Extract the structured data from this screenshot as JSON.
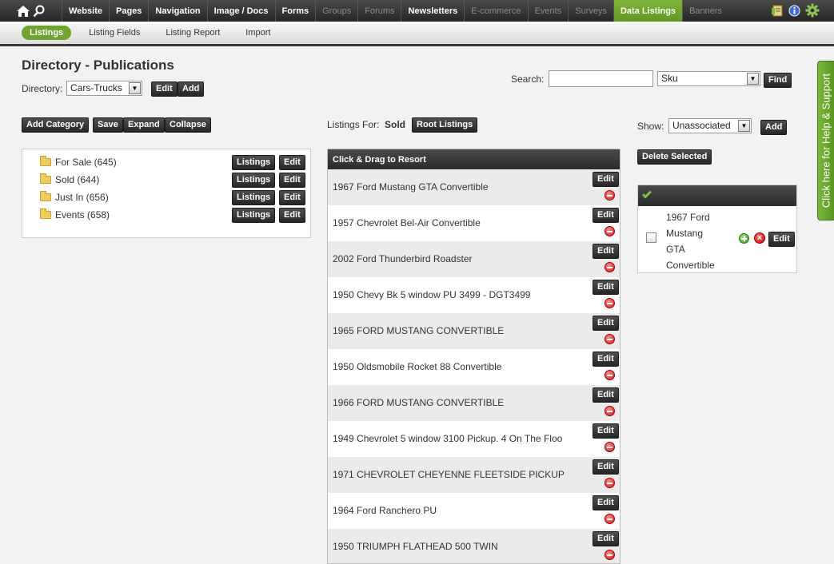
{
  "topnav": {
    "items": [
      {
        "label": "Website",
        "state": "normal"
      },
      {
        "label": "Pages",
        "state": "normal"
      },
      {
        "label": "Navigation",
        "state": "normal"
      },
      {
        "label": "Image / Docs",
        "state": "normal"
      },
      {
        "label": "Forms",
        "state": "normal"
      },
      {
        "label": "Groups",
        "state": "dim"
      },
      {
        "label": "Forums",
        "state": "dim"
      },
      {
        "label": "Newsletters",
        "state": "normal"
      },
      {
        "label": "E-commerce",
        "state": "dim"
      },
      {
        "label": "Events",
        "state": "dim"
      },
      {
        "label": "Surveys",
        "state": "dim"
      },
      {
        "label": "Data Listings",
        "state": "active"
      },
      {
        "label": "Banners",
        "state": "dim"
      }
    ],
    "icons": [
      "home-icon",
      "search-icon",
      "notes-icon",
      "info-icon",
      "gear-icon"
    ]
  },
  "subnav": {
    "items": [
      {
        "label": "Listings",
        "active": true
      },
      {
        "label": "Listing Fields",
        "active": false
      },
      {
        "label": "Listing Report",
        "active": false
      },
      {
        "label": "Import",
        "active": false
      }
    ]
  },
  "page": {
    "title": "Directory - Publications",
    "directory_label": "Directory:",
    "directory_value": "Cars-Trucks",
    "edit_label": "Edit",
    "add_label": "Add"
  },
  "search": {
    "label": "Search:",
    "value": "",
    "field_value": "Sku",
    "find_label": "Find"
  },
  "tree_toolbar": {
    "add_category": "Add Category",
    "save": "Save",
    "expand": "Expand",
    "collapse": "Collapse"
  },
  "categories": [
    {
      "name": "For Sale (645)"
    },
    {
      "name": "Sold (644)"
    },
    {
      "name": "Just In (656)"
    },
    {
      "name": "Events (658)"
    }
  ],
  "tree_row_buttons": {
    "listings": "Listings",
    "edit": "Edit"
  },
  "listings": {
    "for_label": "Listings For:",
    "for_value": "Sold",
    "root_button": "Root Listings",
    "header": "Click & Drag to Resort",
    "edit_label": "Edit",
    "items": [
      "1967 Ford Mustang GTA Convertible",
      "1957 Chevrolet Bel-Air Convertible",
      "2002 Ford Thunderbird Roadster",
      "1950 Chevy Bk 5 window PU 3499 - DGT3499",
      "1965 FORD MUSTANG CONVERTIBLE",
      "1950 Oldsmobile Rocket 88 Convertible",
      "1966 FORD MUSTANG CONVERTIBLE",
      "1949 Chevrolet 5 window 3100 Pickup. 4 On The Floo",
      "1971 CHEVROLET CHEYENNE FLEETSIDE PICKUP",
      "1964 Ford Ranchero PU",
      "1950 TRIUMPH FLATHEAD 500 TWIN"
    ]
  },
  "show": {
    "label": "Show:",
    "value": "Unassociated",
    "add_label": "Add",
    "delete_selected": "Delete Selected"
  },
  "associated": {
    "lines": [
      "1967 Ford",
      "Mustang",
      "GTA",
      "Convertible"
    ],
    "edit_label": "Edit"
  },
  "help": {
    "label": "Click here for Help & Support"
  },
  "colors": {
    "accent": "#6ea52c",
    "dark": "#2b2b2b"
  }
}
